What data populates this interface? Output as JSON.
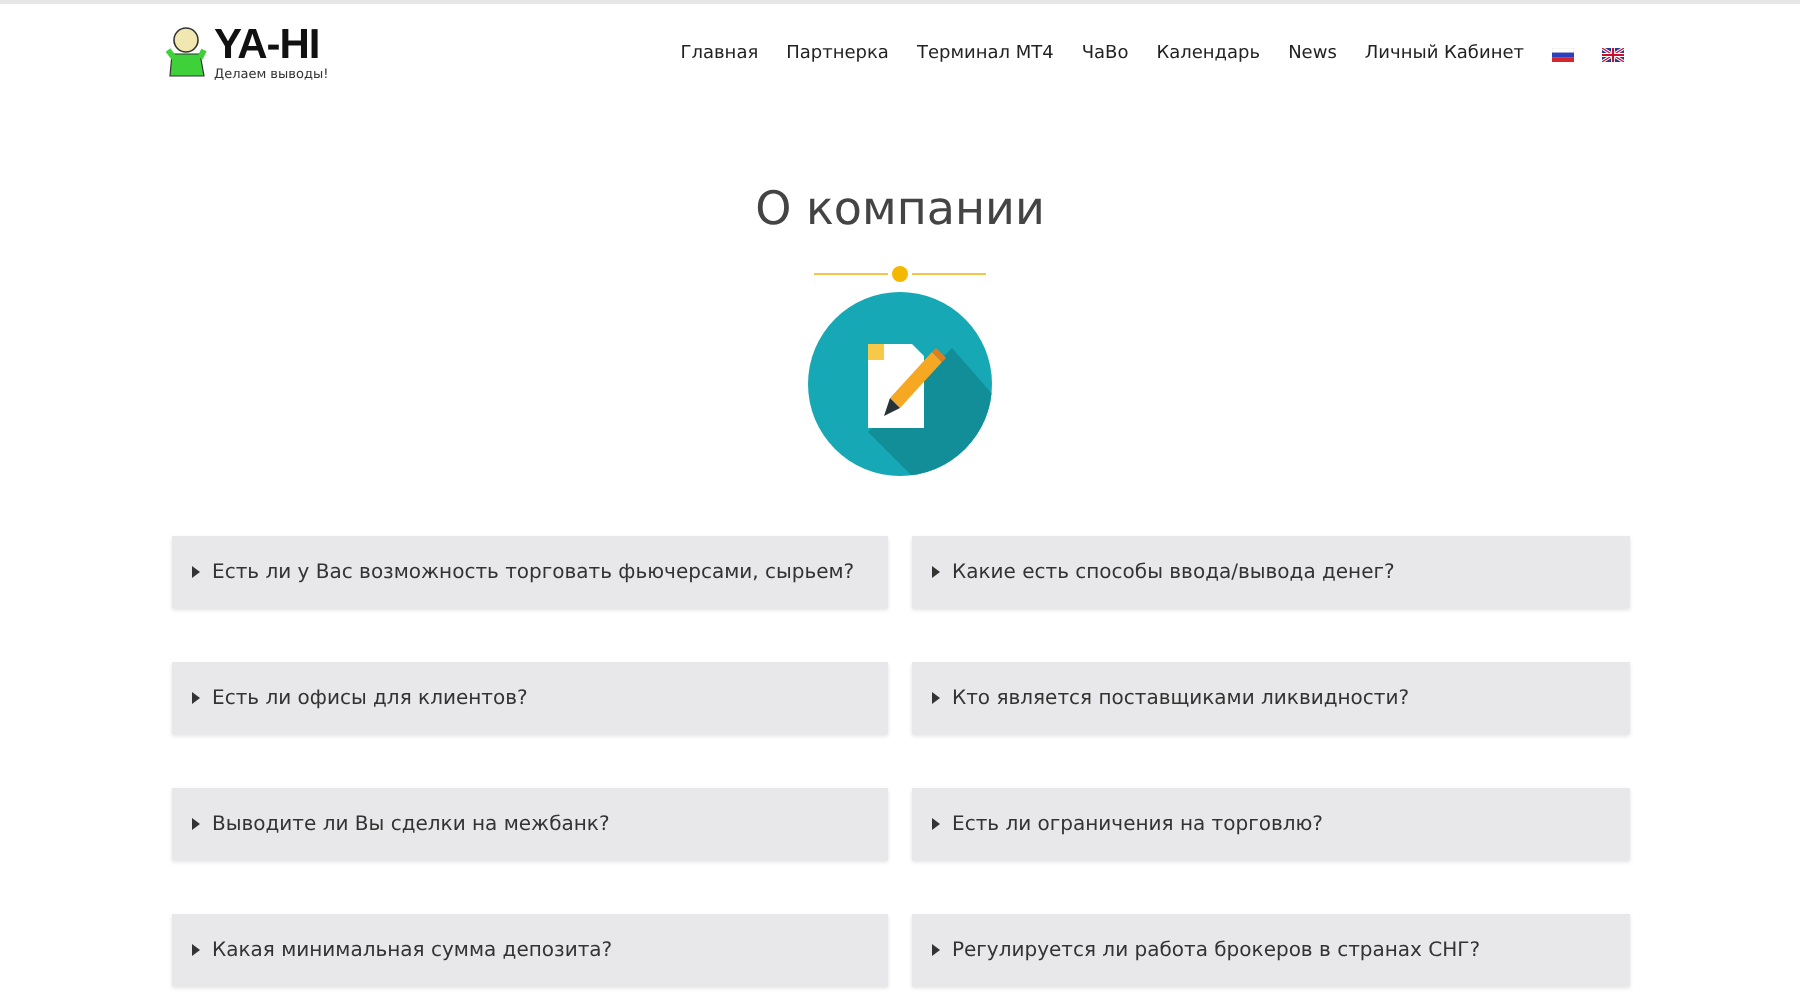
{
  "logo": {
    "name": "YA-HI",
    "tagline": "Делаем выводы!"
  },
  "nav": [
    {
      "label": "Главная",
      "kind": "link"
    },
    {
      "label": "Партнерка",
      "kind": "link"
    },
    {
      "label": "Терминал MT4",
      "kind": "link"
    },
    {
      "label": "ЧаВо",
      "kind": "link"
    },
    {
      "label": "Календарь",
      "kind": "link"
    },
    {
      "label": "News",
      "kind": "link"
    },
    {
      "label": "Личный Кабинет",
      "kind": "link"
    },
    {
      "kind": "flag-ru"
    },
    {
      "kind": "flag-uk"
    }
  ],
  "title": "О компании",
  "faq": [
    {
      "question": "Есть ли у Вас возможность торговать фьючерсами, сырьем?",
      "expanded": false
    },
    {
      "question": "Какие есть способы ввода/вывода денег?",
      "expanded": false
    },
    {
      "question": "Есть ли офисы для клиентов?",
      "expanded": false
    },
    {
      "question": "Кто является поставщиками ликвидности?",
      "expanded": false
    },
    {
      "question": "Выводите ли Вы сделки на межбанк?",
      "expanded": false
    },
    {
      "question": "Есть ли ограничения на торговлю?",
      "expanded": false
    },
    {
      "question": "Какая минимальная сумма депозита?",
      "expanded": false
    },
    {
      "question": "Регулируется ли работа брокеров в странах СНГ?",
      "expanded": false
    }
  ]
}
